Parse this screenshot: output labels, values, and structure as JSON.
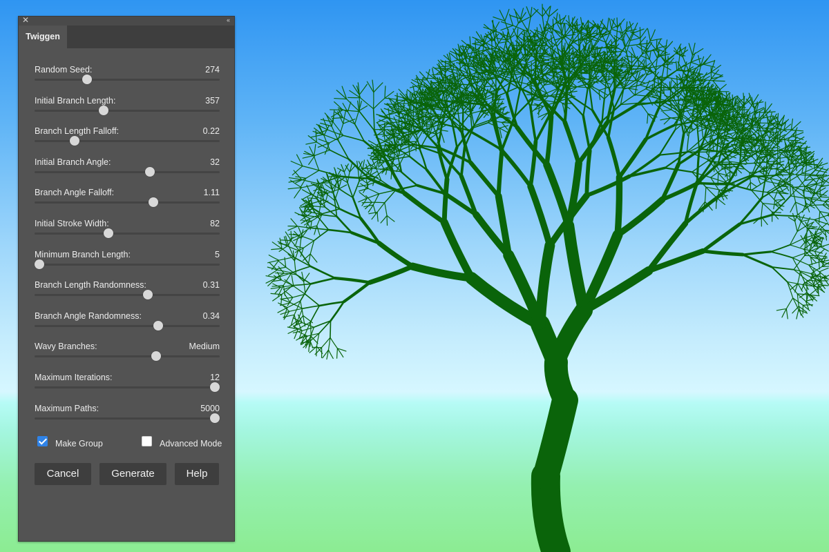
{
  "colors": {
    "tree": "#0a640a",
    "panel_bg": "#535353",
    "checkbox_accent": "#2f83e8"
  },
  "panel": {
    "close_icon": "close-icon",
    "collapse_icon": "collapse-double-chevron-icon",
    "tab": "Twiggen",
    "sliders": [
      {
        "label": "Random Seed:",
        "value": "274",
        "position": 0.283
      },
      {
        "label": "Initial Branch Length:",
        "value": "357",
        "position": 0.373
      },
      {
        "label": "Branch Length Falloff:",
        "value": "0.22",
        "position": 0.216
      },
      {
        "label": "Initial Branch Angle:",
        "value": "32",
        "position": 0.623
      },
      {
        "label": "Branch Angle Falloff:",
        "value": "1.11",
        "position": 0.642
      },
      {
        "label": "Initial Stroke Width:",
        "value": "82",
        "position": 0.399
      },
      {
        "label": "Minimum Branch Length:",
        "value": "5",
        "position": 0.026
      },
      {
        "label": "Branch Length Randomness:",
        "value": "0.31",
        "position": 0.612
      },
      {
        "label": "Branch Angle Randomness:",
        "value": "0.34",
        "position": 0.668
      },
      {
        "label": "Wavy Branches:",
        "value": "Medium",
        "position": 0.657
      },
      {
        "label": "Maximum Iterations:",
        "value": "12",
        "position": 0.974
      },
      {
        "label": "Maximum Paths:",
        "value": "5000",
        "position": 0.974
      }
    ],
    "make_group": {
      "label": "Make Group",
      "checked": true
    },
    "advanced_mode": {
      "label": "Advanced Mode",
      "checked": false
    },
    "buttons": {
      "cancel": "Cancel",
      "generate": "Generate",
      "help": "Help"
    }
  }
}
